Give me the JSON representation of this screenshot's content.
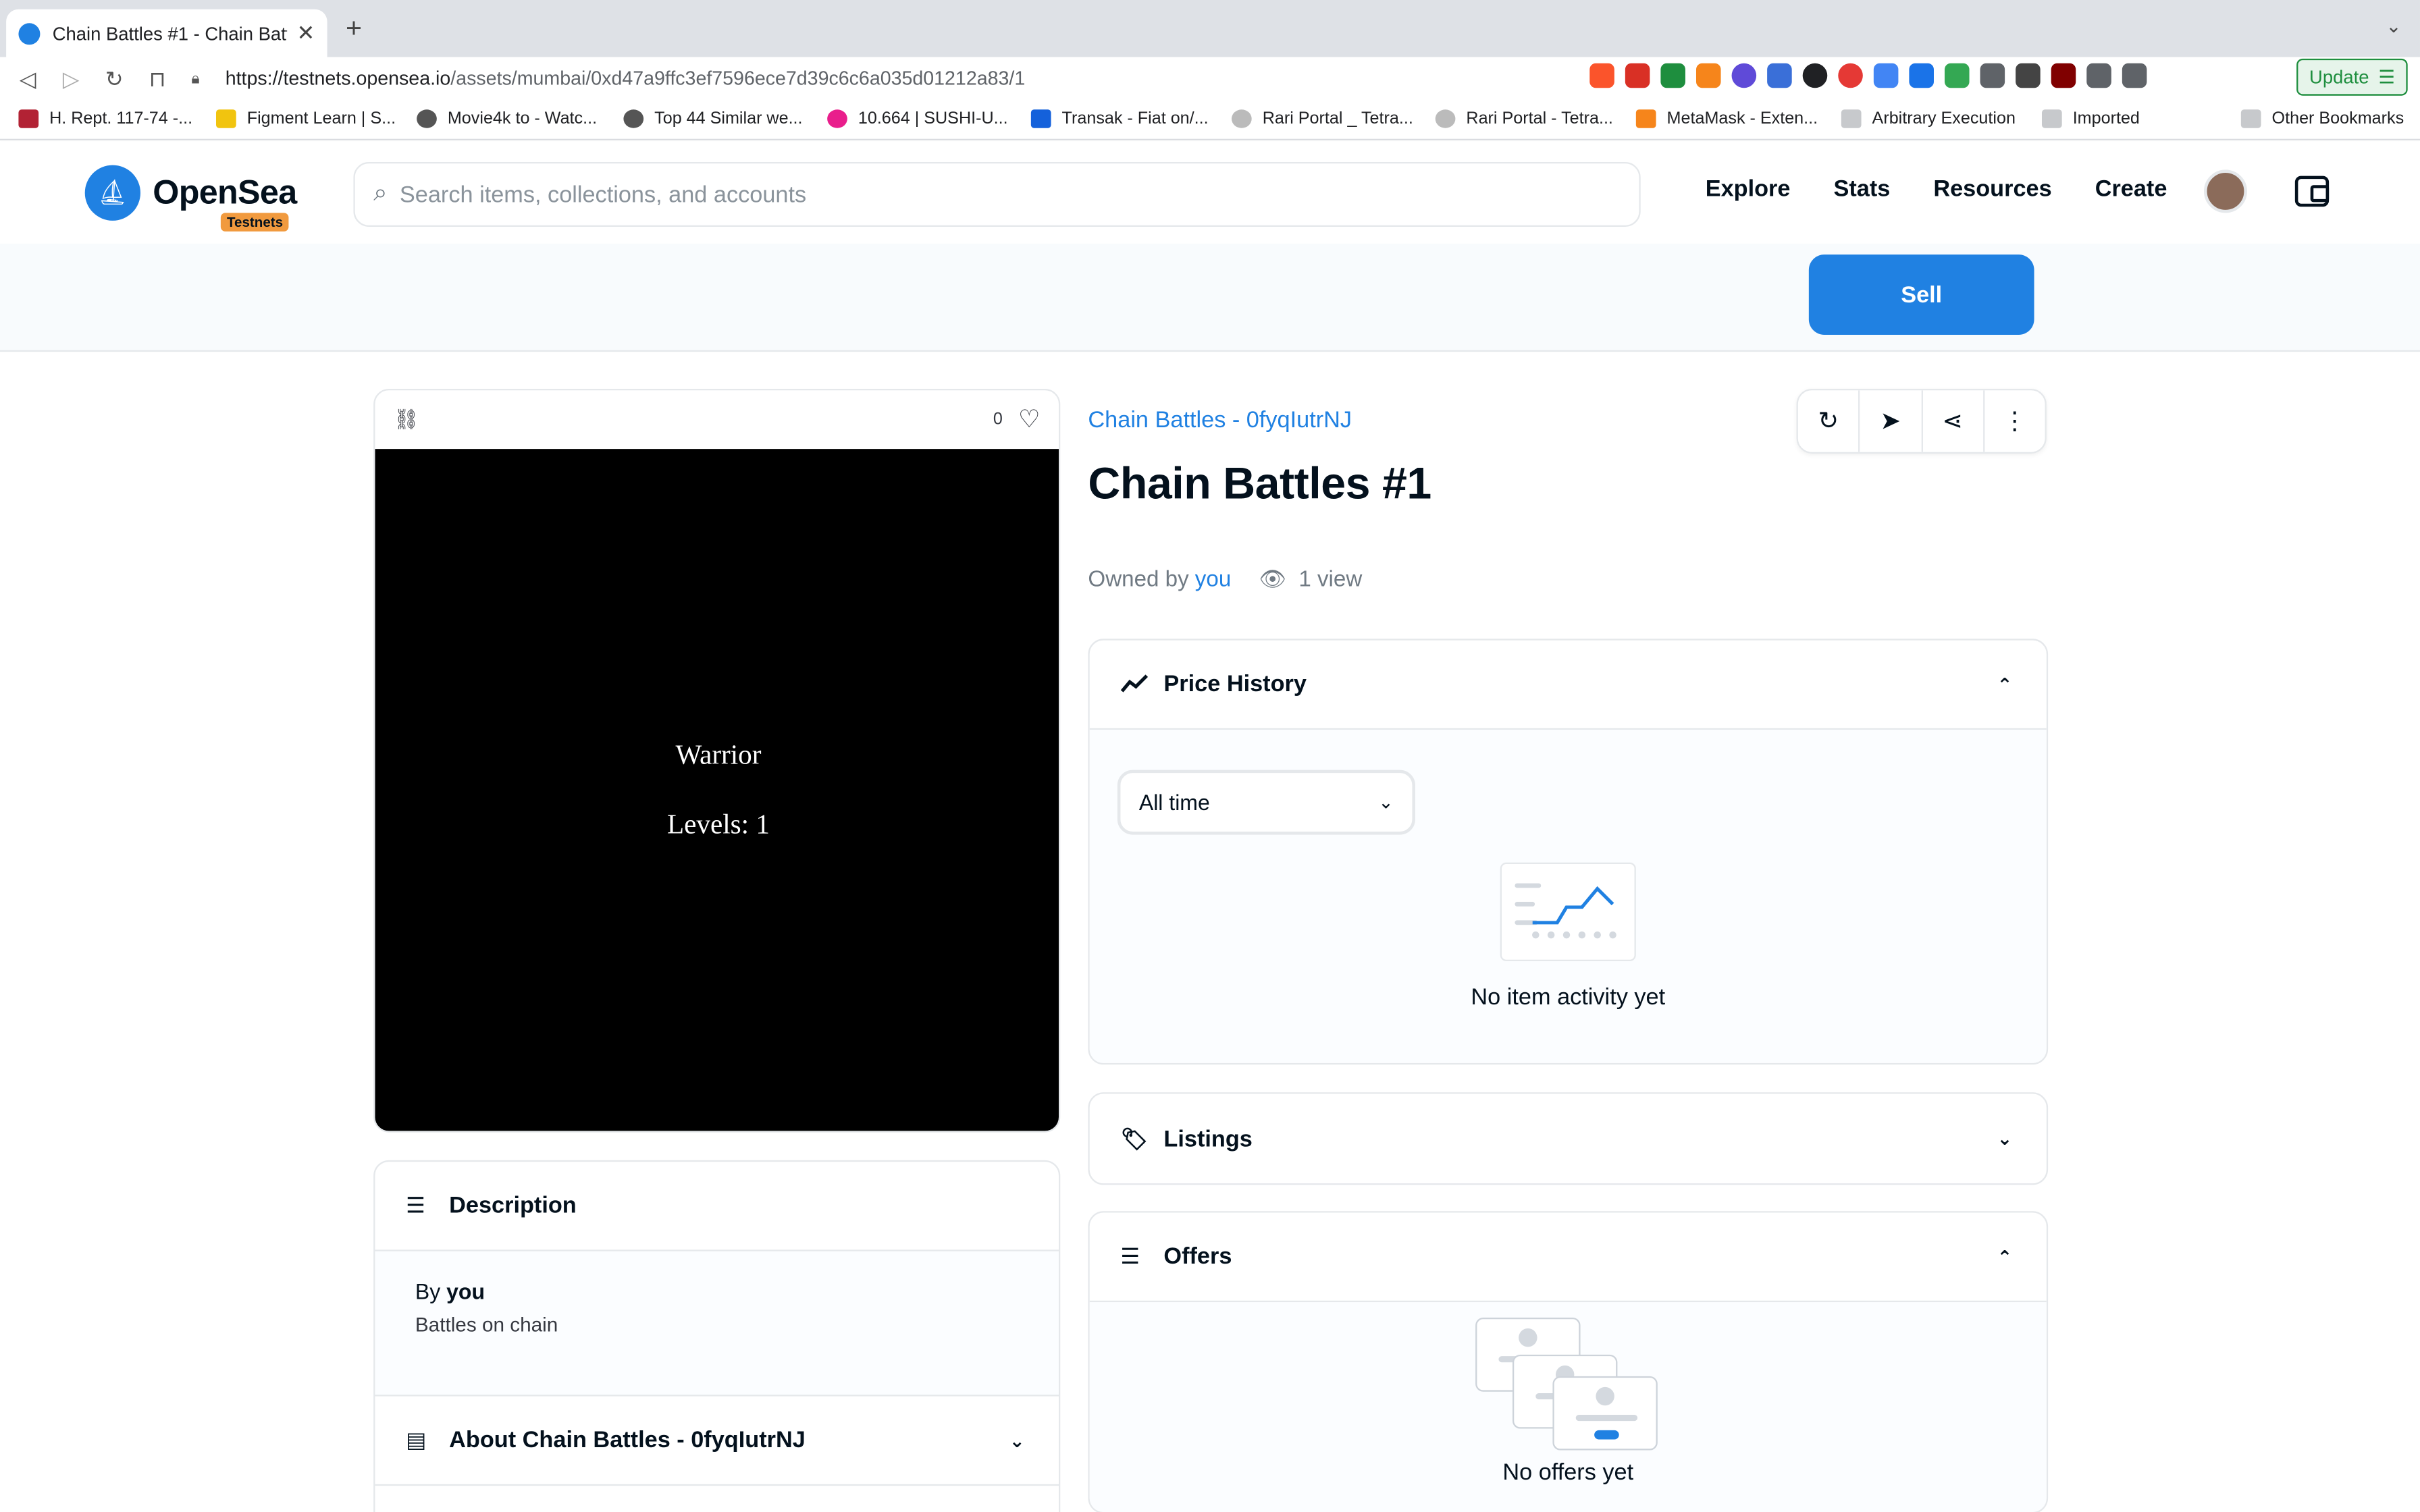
{
  "browser": {
    "tab_title": "Chain Battles #1 - Chain Battles",
    "new_tab": "+",
    "url_host": "https://testnets.opensea.io",
    "url_path": "/assets/mumbai/0xd47a9ffc3ef7596ece7d39c6c6a035d01212a83/1",
    "update_label": "Update",
    "bookmarks": [
      "H. Rept. 117-74 -...",
      "Figment Learn | S...",
      "Movie4k to - Watc...",
      "Top 44 Similar we...",
      "10.664 | SUSHI-U...",
      "Transak - Fiat on/...",
      "Rari Portal _ Tetra...",
      "Rari Portal - Tetra...",
      "MetaMask - Exten...",
      "Arbitrary Execution",
      "Imported",
      "Other Bookmarks"
    ]
  },
  "header": {
    "logo_text": "OpenSea",
    "badge": "Testnets",
    "search_placeholder": "Search items, collections, and accounts",
    "nav": [
      "Explore",
      "Stats",
      "Resources",
      "Create"
    ]
  },
  "sell_label": "Sell",
  "asset": {
    "favorites_count": "0",
    "image_line1": "Warrior",
    "image_line2": "Levels: 1",
    "collection": "Chain Battles - 0fyqIutrNJ",
    "title": "Chain Battles #1",
    "owned_by": "Owned by",
    "owner": "you",
    "views": "1 view"
  },
  "description": {
    "heading": "Description",
    "by": "By",
    "creator": "you",
    "text": "Battles on chain",
    "about_heading": "About Chain Battles - 0fyqIutrNJ"
  },
  "price_history": {
    "heading": "Price History",
    "filter": "All time",
    "empty": "No item activity yet"
  },
  "listings": {
    "heading": "Listings"
  },
  "offers": {
    "heading": "Offers",
    "empty": "No offers yet"
  }
}
